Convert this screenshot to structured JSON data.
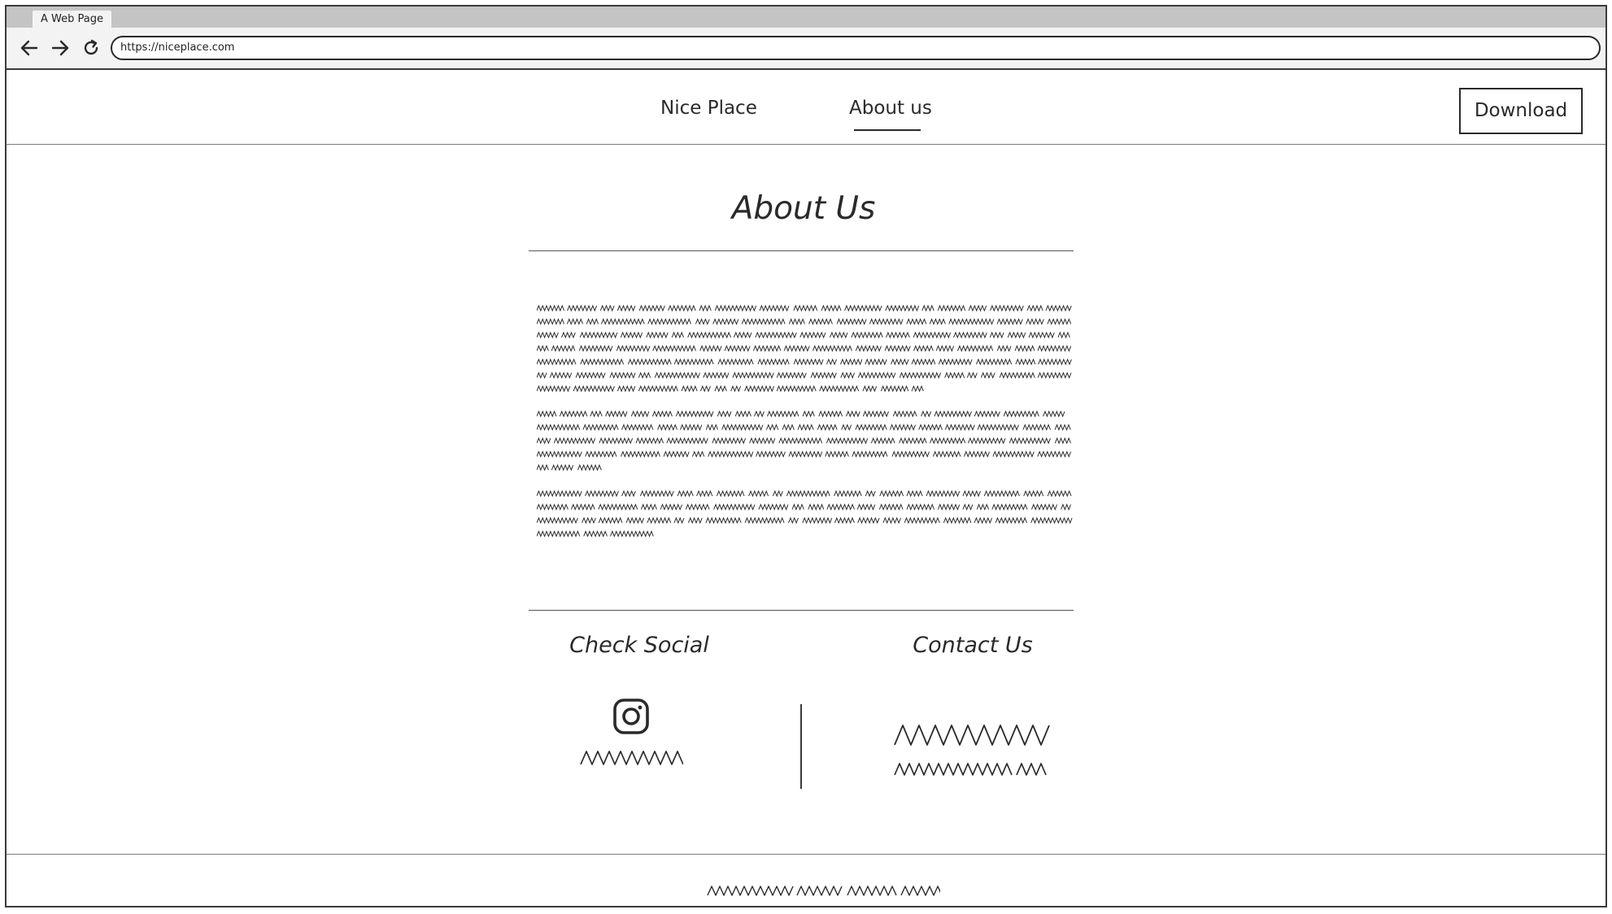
{
  "browser": {
    "tab_title": "A Web Page",
    "url": "https://niceplace.com",
    "icons": [
      "back-arrow-icon",
      "forward-arrow-icon",
      "reload-icon"
    ]
  },
  "header": {
    "nav": [
      {
        "label": "Nice Place",
        "active": false
      },
      {
        "label": "About us",
        "active": true
      }
    ],
    "download_label": "Download"
  },
  "main": {
    "title": "About Us"
  },
  "social": {
    "title": "Check Social",
    "icon": "instagram-icon"
  },
  "contact": {
    "title": "Contact Us"
  }
}
